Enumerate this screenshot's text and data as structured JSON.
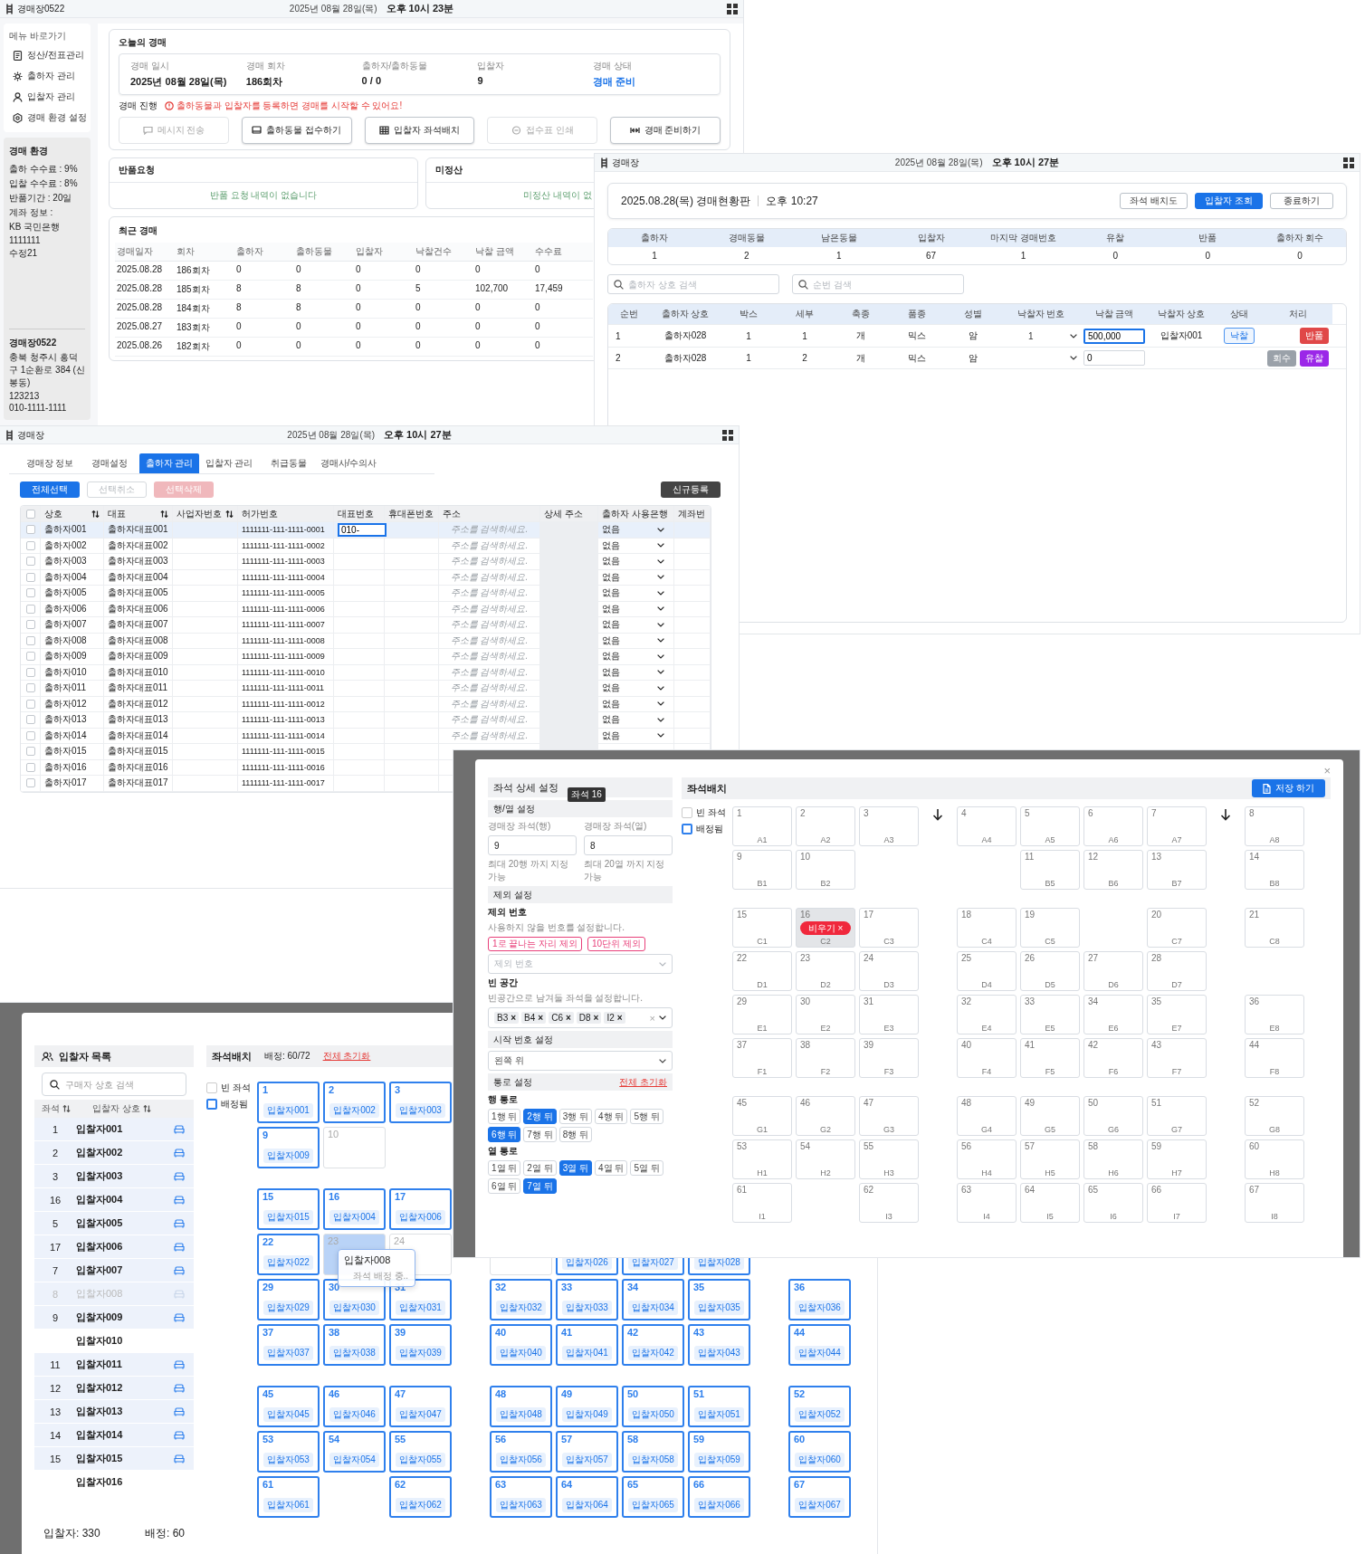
{
  "dashboard_window": {
    "app_name": "경매장0522",
    "date": "2025년 08월 28일(목)",
    "time": "오후 10시 23분",
    "menu_title": "메뉴 바로가기",
    "menu": [
      "정산/전표관리",
      "출하자 관리",
      "입찰자 관리",
      "경매 환경 설정"
    ],
    "settings_panel": {
      "title": "경매 환경",
      "lines": [
        "출하 수수료 : 9%",
        "입찰 수수료 : 8%",
        "반품기간 : 20일",
        "계좌 정보 :",
        "KB 국민은행",
        "1111111",
        "수정21"
      ]
    },
    "footer": {
      "name": "경매장0522",
      "address": "충북 청주시 흥덕구 1순환로 384 (신봉동)",
      "code": "123213",
      "phone": "010-1111-1111"
    },
    "today": {
      "title": "오늘의 경매",
      "fields": [
        {
          "label": "경매 일시",
          "value": "2025년 08월 28일(목)",
          "highlight": false
        },
        {
          "label": "경매 회차",
          "value": "186회차",
          "highlight": false
        },
        {
          "label": "출하자/출하동물",
          "value": "0 / 0",
          "highlight": false
        },
        {
          "label": "입찰자",
          "value": "9",
          "highlight": false
        },
        {
          "label": "경매 상태",
          "value": "경매 준비",
          "highlight": true
        }
      ]
    },
    "progress_label": "경매 진행",
    "warning": "출하동물과 입찰자를 등록하면 경매를 시작할 수 있어요!",
    "actions": [
      {
        "label": "메시지 전송",
        "disabled": true
      },
      {
        "label": "출하동물 접수하기",
        "disabled": false
      },
      {
        "label": "입찰자 좌석배치",
        "disabled": false
      },
      {
        "label": "접수표 인쇄",
        "disabled": true
      },
      {
        "label": "경매 준비하기",
        "disabled": false
      }
    ],
    "returns": {
      "title": "반품요청",
      "empty": "반품 요청 내역이 없습니다"
    },
    "unsettled": {
      "title": "미정산",
      "empty": "미정산 내역이 없"
    },
    "recent": {
      "title": "최근 경매",
      "columns": [
        "경매일자",
        "회차",
        "출하자",
        "출하동물",
        "입찰자",
        "낙찰건수",
        "낙찰 금액",
        "수수료"
      ],
      "rows": [
        [
          "2025.08.28",
          "186회차",
          "0",
          "0",
          "0",
          "0",
          "0",
          "0"
        ],
        [
          "2025.08.28",
          "185회차",
          "8",
          "8",
          "0",
          "5",
          "102,700",
          "17,459"
        ],
        [
          "2025.08.28",
          "184회차",
          "8",
          "8",
          "0",
          "0",
          "0",
          "0"
        ],
        [
          "2025.08.27",
          "183회차",
          "0",
          "0",
          "0",
          "0",
          "0",
          "0"
        ],
        [
          "2025.08.26",
          "182회차",
          "0",
          "0",
          "0",
          "0",
          "0",
          "0"
        ]
      ]
    }
  },
  "auction_board_window": {
    "app_name": "경매장",
    "date": "2025년 08월 28일(목)",
    "time": "오후 10시 27분",
    "board_title": "2025.08.28(목) 경매현황판",
    "board_time": "오후 10:27",
    "buttons": [
      {
        "label": "좌석 배치도",
        "primary": false
      },
      {
        "label": "입찰자 조회",
        "primary": true
      },
      {
        "label": "종료하기",
        "primary": false
      }
    ],
    "stats": {
      "columns": [
        "출하자",
        "경매동물",
        "남은동물",
        "입찰자",
        "마지막 경매번호",
        "유찰",
        "반품",
        "출하자 회수"
      ],
      "values": [
        "1",
        "2",
        "1",
        "67",
        "1",
        "0",
        "0",
        "0"
      ]
    },
    "searches": [
      {
        "placeholder": "출하자 상호 검색"
      },
      {
        "placeholder": "순번 검색"
      }
    ],
    "table": {
      "columns": [
        "순번",
        "출하자 상호",
        "박스",
        "세부",
        "축종",
        "품종",
        "성별",
        "낙찰자 번호",
        "낙찰 금액",
        "낙찰자 상호",
        "상태",
        "처리"
      ],
      "rows": [
        {
          "cells": [
            "1",
            "출하자028",
            "1",
            "1",
            "개",
            "믹스",
            "암"
          ],
          "bidder_no": "1",
          "amount": "500,000",
          "amount_focused": true,
          "bidder_name": "입찰자001",
          "status": "낙찰",
          "actions": [
            {
              "label": "반품",
              "kind": "return"
            }
          ]
        },
        {
          "cells": [
            "2",
            "출하자028",
            "1",
            "2",
            "개",
            "믹스",
            "암"
          ],
          "amount": "0",
          "amount_focused": false,
          "actions": [
            {
              "label": "회수",
              "kind": "recall"
            },
            {
              "label": "유찰",
              "kind": "fail"
            }
          ]
        }
      ]
    }
  },
  "shipper_window": {
    "app_name": "경매장",
    "date": "2025년 08월 28일(목)",
    "time": "오후 10시 27분",
    "tabs": [
      {
        "label": "경매장 정보",
        "selected": false
      },
      {
        "label": "경매설정",
        "selected": false
      },
      {
        "label": "출하자 관리",
        "selected": true
      },
      {
        "label": "입찰자 관리",
        "selected": false
      },
      {
        "label": "취급동물",
        "selected": false
      },
      {
        "label": "경매사/수의사",
        "selected": false
      }
    ],
    "bulk_buttons": [
      {
        "label": "전체선택",
        "kind": "primary"
      },
      {
        "label": "선택취소",
        "kind": "outline"
      },
      {
        "label": "선택삭제",
        "kind": "danger"
      }
    ],
    "new_button": "신규등록",
    "table": {
      "header_checked": false,
      "columns": [
        {
          "label": "상호",
          "sortable": true
        },
        {
          "label": "대표",
          "sortable": true
        },
        {
          "label": "사업자번호",
          "sortable": true
        },
        {
          "label": "허가번호",
          "sortable": false
        },
        {
          "label": "대표번호",
          "sortable": false
        },
        {
          "label": "휴대폰번호",
          "sortable": false
        },
        {
          "label": "주소",
          "sortable": false
        },
        {
          "label": "상세 주소",
          "sortable": false
        },
        {
          "label": "출하자 사용은행",
          "sortable": false
        },
        {
          "label": "계좌번",
          "sortable": false
        }
      ],
      "rows": [
        {
          "checked": false,
          "selected": true,
          "name": "출하자001",
          "rep": "출하자대표001",
          "license": "1111111-111-1111-0001",
          "phone": "010-",
          "address_placeholder": "주소를 검색하세요.",
          "bank": "없음"
        },
        {
          "checked": false,
          "selected": false,
          "name": "출하자002",
          "rep": "출하자대표002",
          "license": "1111111-111-1111-0002",
          "address_placeholder": "주소를 검색하세요.",
          "bank": "없음"
        },
        {
          "checked": false,
          "selected": false,
          "name": "출하자003",
          "rep": "출하자대표003",
          "license": "1111111-111-1111-0003",
          "address_placeholder": "주소를 검색하세요.",
          "bank": "없음"
        },
        {
          "checked": false,
          "selected": false,
          "name": "출하자004",
          "rep": "출하자대표004",
          "license": "1111111-111-1111-0004",
          "address_placeholder": "주소를 검색하세요.",
          "bank": "없음"
        },
        {
          "checked": false,
          "selected": false,
          "name": "출하자005",
          "rep": "출하자대표005",
          "license": "1111111-111-1111-0005",
          "address_placeholder": "주소를 검색하세요.",
          "bank": "없음"
        },
        {
          "checked": false,
          "selected": false,
          "name": "출하자006",
          "rep": "출하자대표006",
          "license": "1111111-111-1111-0006",
          "address_placeholder": "주소를 검색하세요.",
          "bank": "없음"
        },
        {
          "checked": false,
          "selected": false,
          "name": "출하자007",
          "rep": "출하자대표007",
          "license": "1111111-111-1111-0007",
          "address_placeholder": "주소를 검색하세요.",
          "bank": "없음"
        },
        {
          "checked": false,
          "selected": false,
          "name": "출하자008",
          "rep": "출하자대표008",
          "license": "1111111-111-1111-0008",
          "address_placeholder": "주소를 검색하세요.",
          "bank": "없음"
        },
        {
          "checked": false,
          "selected": false,
          "name": "출하자009",
          "rep": "출하자대표009",
          "license": "1111111-111-1111-0009",
          "address_placeholder": "주소를 검색하세요.",
          "bank": "없음"
        },
        {
          "checked": false,
          "selected": false,
          "name": "출하자010",
          "rep": "출하자대표010",
          "license": "1111111-111-1111-0010",
          "address_placeholder": "주소를 검색하세요.",
          "bank": "없음"
        },
        {
          "checked": false,
          "selected": false,
          "name": "출하자011",
          "rep": "출하자대표011",
          "license": "1111111-111-1111-0011",
          "address_placeholder": "주소를 검색하세요.",
          "bank": "없음"
        },
        {
          "checked": false,
          "selected": false,
          "name": "출하자012",
          "rep": "출하자대표012",
          "license": "1111111-111-1111-0012",
          "address_placeholder": "주소를 검색하세요.",
          "bank": "없음"
        },
        {
          "checked": false,
          "selected": false,
          "name": "출하자013",
          "rep": "출하자대표013",
          "license": "1111111-111-1111-0013",
          "address_placeholder": "주소를 검색하세요.",
          "bank": "없음"
        },
        {
          "checked": false,
          "selected": false,
          "name": "출하자014",
          "rep": "출하자대표014",
          "license": "1111111-111-1111-0014",
          "address_placeholder": "주소를 검색하세요.",
          "bank": "없음"
        },
        {
          "checked": false,
          "selected": false,
          "name": "출하자015",
          "rep": "출하자대표015",
          "license": "1111111-111-1111-0015"
        },
        {
          "checked": false,
          "selected": false,
          "name": "출하자016",
          "rep": "출하자대표016",
          "license": "1111111-111-1111-0016"
        },
        {
          "checked": false,
          "selected": false,
          "name": "출하자017",
          "rep": "출하자대표017",
          "license": "1111111-111-1111-0017"
        }
      ]
    }
  },
  "seat_settings_dialog": {
    "title": "좌석 상세 설정",
    "tooltip": "좌석 16",
    "close": "×",
    "rowcol": {
      "title": "행/열 설정",
      "fields": [
        {
          "label": "경매장 좌석(행)",
          "value": "9",
          "hint": "최대 20행 까지 지정 가능"
        },
        {
          "label": "경매장 좌석(열)",
          "value": "8",
          "hint": "최대 20열 까지 지정 가능"
        }
      ]
    },
    "exclude": {
      "title": "제외 설정",
      "label": "제외 번호",
      "description": "사용하지 않을 번호를 설정합니다.",
      "presets": [
        "1로 끝나는 자리 제외",
        "10단위 제외"
      ],
      "placeholder": "제외 번호"
    },
    "blank": {
      "label": "빈 공간",
      "description": "빈공간으로 남겨둘 좌석을 설정합니다.",
      "tags": [
        "B3",
        "B4",
        "C6",
        "D8",
        "I2"
      ],
      "remove": "×",
      "clear": "×"
    },
    "start": {
      "title": "시작 번호 설정",
      "value": "왼쪽 위"
    },
    "aisle": {
      "title": "통로 설정",
      "reset": "전체 초기화",
      "row_label": "행 통로",
      "rows": [
        {
          "label": "1행 뒤",
          "selected": false
        },
        {
          "label": "2행 뒤",
          "selected": true
        },
        {
          "label": "3행 뒤",
          "selected": false
        },
        {
          "label": "4행 뒤",
          "selected": false
        },
        {
          "label": "5행 뒤",
          "selected": false
        },
        {
          "label": "6행 뒤",
          "selected": true
        },
        {
          "label": "7행 뒤",
          "selected": false
        },
        {
          "label": "8행 뒤",
          "selected": false
        }
      ],
      "col_label": "열 통로",
      "cols": [
        {
          "label": "1열 뒤",
          "selected": false
        },
        {
          "label": "2열 뒤",
          "selected": false
        },
        {
          "label": "3열 뒤",
          "selected": true
        },
        {
          "label": "4열 뒤",
          "selected": false
        },
        {
          "label": "5열 뒤",
          "selected": false
        },
        {
          "label": "6열 뒤",
          "selected": false
        },
        {
          "label": "7열 뒤",
          "selected": true
        }
      ]
    },
    "layout_title": "좌석배치",
    "save": "저장 하기",
    "legend": [
      {
        "label": "빈 좌석",
        "kind": "empty"
      },
      {
        "label": "배정됨",
        "kind": "assigned"
      }
    ],
    "grid": [
      [
        {
          "num": "1",
          "code": "A1",
          "selected": false
        },
        {
          "num": "2",
          "code": "A2",
          "selected": false
        },
        {
          "num": "3",
          "code": "A3",
          "selected": false
        },
        {
          "num": "4",
          "code": "A4",
          "selected": false
        },
        {
          "num": "5",
          "code": "A5",
          "selected": false
        },
        {
          "num": "6",
          "code": "A6",
          "selected": false
        },
        {
          "num": "7",
          "code": "A7",
          "selected": false
        },
        {
          "num": "8",
          "code": "A8",
          "selected": false
        }
      ],
      [
        {
          "num": "9",
          "code": "B1",
          "selected": false
        },
        {
          "num": "10",
          "code": "B2",
          "selected": false
        },
        {
          "kind": "space"
        },
        {
          "kind": "space"
        },
        {
          "num": "11",
          "code": "B5",
          "selected": false
        },
        {
          "num": "12",
          "code": "B6",
          "selected": false
        },
        {
          "num": "13",
          "code": "B7",
          "selected": false
        },
        {
          "num": "14",
          "code": "B8",
          "selected": false
        }
      ],
      [
        {
          "num": "15",
          "code": "C1",
          "selected": false
        },
        {
          "num": "16",
          "code": "C2",
          "selected": true,
          "action": "비우기",
          "action_close": "×"
        },
        {
          "num": "17",
          "code": "C3",
          "selected": false
        },
        {
          "num": "18",
          "code": "C4",
          "selected": false
        },
        {
          "num": "19",
          "code": "C5",
          "selected": false
        },
        {
          "kind": "space"
        },
        {
          "num": "20",
          "code": "C7",
          "selected": false
        },
        {
          "num": "21",
          "code": "C8",
          "selected": false
        }
      ],
      [
        {
          "num": "22",
          "code": "D1",
          "selected": false
        },
        {
          "num": "23",
          "code": "D2",
          "selected": false
        },
        {
          "num": "24",
          "code": "D3",
          "selected": false
        },
        {
          "num": "25",
          "code": "D4",
          "selected": false
        },
        {
          "num": "26",
          "code": "D5",
          "selected": false
        },
        {
          "num": "27",
          "code": "D6",
          "selected": false
        },
        {
          "num": "28",
          "code": "D7",
          "selected": false
        },
        {
          "kind": "space"
        }
      ],
      [
        {
          "num": "29",
          "code": "E1",
          "selected": false
        },
        {
          "num": "30",
          "code": "E2",
          "selected": false
        },
        {
          "num": "31",
          "code": "E3",
          "selected": false
        },
        {
          "num": "32",
          "code": "E4",
          "selected": false
        },
        {
          "num": "33",
          "code": "E5",
          "selected": false
        },
        {
          "num": "34",
          "code": "E6",
          "selected": false
        },
        {
          "num": "35",
          "code": "E7",
          "selected": false
        },
        {
          "num": "36",
          "code": "E8",
          "selected": false
        }
      ],
      [
        {
          "num": "37",
          "code": "F1",
          "selected": false
        },
        {
          "num": "38",
          "code": "F2",
          "selected": false
        },
        {
          "num": "39",
          "code": "F3",
          "selected": false
        },
        {
          "num": "40",
          "code": "F4",
          "selected": false
        },
        {
          "num": "41",
          "code": "F5",
          "selected": false
        },
        {
          "num": "42",
          "code": "F6",
          "selected": false
        },
        {
          "num": "43",
          "code": "F7",
          "selected": false
        },
        {
          "num": "44",
          "code": "F8",
          "selected": false
        }
      ],
      [
        {
          "num": "45",
          "code": "G1",
          "selected": false
        },
        {
          "num": "46",
          "code": "G2",
          "selected": false
        },
        {
          "num": "47",
          "code": "G3",
          "selected": false
        },
        {
          "num": "48",
          "code": "G4",
          "selected": false
        },
        {
          "num": "49",
          "code": "G5",
          "selected": false
        },
        {
          "num": "50",
          "code": "G6",
          "selected": false
        },
        {
          "num": "51",
          "code": "G7",
          "selected": false
        },
        {
          "num": "52",
          "code": "G8",
          "selected": false
        }
      ],
      [
        {
          "num": "53",
          "code": "H1",
          "selected": false
        },
        {
          "num": "54",
          "code": "H2",
          "selected": false
        },
        {
          "num": "55",
          "code": "H3",
          "selected": false
        },
        {
          "num": "56",
          "code": "H4",
          "selected": false
        },
        {
          "num": "57",
          "code": "H5",
          "selected": false
        },
        {
          "num": "58",
          "code": "H6",
          "selected": false
        },
        {
          "num": "59",
          "code": "H7",
          "selected": false
        },
        {
          "num": "60",
          "code": "H8",
          "selected": false
        }
      ],
      [
        {
          "num": "61",
          "code": "I1",
          "selected": false
        },
        {
          "kind": "space"
        },
        {
          "num": "62",
          "code": "I3",
          "selected": false
        },
        {
          "num": "63",
          "code": "I4",
          "selected": false
        },
        {
          "num": "64",
          "code": "I5",
          "selected": false
        },
        {
          "num": "65",
          "code": "I6",
          "selected": false
        },
        {
          "num": "66",
          "code": "I7",
          "selected": false
        },
        {
          "num": "67",
          "code": "I8",
          "selected": false
        }
      ]
    ]
  },
  "seat_assignment_window": {
    "list_title": "입찰자 목록",
    "search_placeholder": "구매자 상호 검색",
    "columns": [
      "좌석",
      "입찰자 상호"
    ],
    "bidders": [
      {
        "seat": "1",
        "name": "입찰자001",
        "assigned": true,
        "disabled": false
      },
      {
        "seat": "2",
        "name": "입찰자002",
        "assigned": true,
        "disabled": false
      },
      {
        "seat": "3",
        "name": "입찰자003",
        "assigned": true,
        "disabled": false
      },
      {
        "seat": "16",
        "name": "입찰자004",
        "assigned": true,
        "disabled": false
      },
      {
        "seat": "5",
        "name": "입찰자005",
        "assigned": true,
        "disabled": false
      },
      {
        "seat": "17",
        "name": "입찰자006",
        "assigned": true,
        "disabled": false
      },
      {
        "seat": "7",
        "name": "입찰자007",
        "assigned": true,
        "disabled": false
      },
      {
        "seat": "8",
        "name": "입찰자008",
        "assigned": true,
        "disabled": true
      },
      {
        "seat": "9",
        "name": "입찰자009",
        "assigned": true,
        "disabled": false
      },
      {
        "name": "입찰자010",
        "assigned": false,
        "disabled": false
      },
      {
        "seat": "11",
        "name": "입찰자011",
        "assigned": true,
        "disabled": false
      },
      {
        "seat": "12",
        "name": "입찰자012",
        "assigned": true,
        "disabled": false
      },
      {
        "seat": "13",
        "name": "입찰자013",
        "assigned": true,
        "disabled": false
      },
      {
        "seat": "14",
        "name": "입찰자014",
        "assigned": true,
        "disabled": false
      },
      {
        "seat": "15",
        "name": "입찰자015",
        "assigned": true,
        "disabled": false
      },
      {
        "name": "입찰자016",
        "assigned": false,
        "disabled": false
      }
    ],
    "total": "입찰자: 330",
    "assigned_count": "배정: 60",
    "layout_title": "좌석배치",
    "summary": "배정: 60/72",
    "reset": "전체 초기화",
    "legend": [
      {
        "label": "빈 좌석",
        "kind": "empty"
      },
      {
        "label": "배정됨",
        "kind": "assigned"
      }
    ],
    "grid": [
      [
        {
          "kind": "seat",
          "num": "1",
          "bidder": "입찰자001"
        },
        {
          "kind": "seat",
          "num": "2",
          "bidder": "입찰자002"
        },
        {
          "kind": "seat",
          "num": "3",
          "bidder": "입찰자003"
        },
        {
          "kind": "covered"
        },
        {
          "kind": "covered"
        },
        {
          "kind": "covered"
        },
        {
          "kind": "covered"
        },
        {
          "kind": "covered"
        }
      ],
      [
        {
          "kind": "seat",
          "num": "9",
          "bidder": "입찰자009"
        },
        {
          "kind": "seat",
          "num": "10"
        },
        {
          "kind": "space"
        },
        {
          "kind": "covered"
        },
        {
          "kind": "covered"
        },
        {
          "kind": "covered"
        },
        {
          "kind": "covered"
        },
        {
          "kind": "covered"
        }
      ],
      [
        {
          "kind": "seat",
          "num": "15",
          "bidder": "입찰자015"
        },
        {
          "kind": "seat",
          "num": "16",
          "bidder": "입찰자004"
        },
        {
          "kind": "seat",
          "num": "17",
          "bidder": "입찰자006"
        },
        {
          "kind": "covered"
        },
        {
          "kind": "covered"
        },
        {
          "kind": "covered"
        },
        {
          "kind": "covered"
        },
        {
          "kind": "covered"
        }
      ],
      [
        {
          "kind": "seat",
          "num": "22",
          "bidder": "입찰자022"
        },
        {
          "kind": "seat",
          "num": "23",
          "target": true,
          "drag": {
            "name": "입찰자008",
            "status": "좌석 배정 중.."
          }
        },
        {
          "kind": "seat",
          "num": "24"
        },
        {
          "kind": "seat"
        },
        {
          "kind": "seat",
          "bidder": "입찰자026"
        },
        {
          "kind": "seat",
          "bidder": "입찰자027"
        },
        {
          "kind": "seat",
          "bidder": "입찰자028"
        },
        {
          "kind": "space"
        }
      ],
      [
        {
          "kind": "seat",
          "num": "29",
          "bidder": "입찰자029"
        },
        {
          "kind": "seat",
          "num": "30",
          "bidder": "입찰자030"
        },
        {
          "kind": "seat",
          "num": "31",
          "bidder": "입찰자031"
        },
        {
          "kind": "seat",
          "num": "32",
          "bidder": "입찰자032"
        },
        {
          "kind": "seat",
          "num": "33",
          "bidder": "입찰자033"
        },
        {
          "kind": "seat",
          "num": "34",
          "bidder": "입찰자034"
        },
        {
          "kind": "seat",
          "num": "35",
          "bidder": "입찰자035"
        },
        {
          "kind": "seat",
          "num": "36",
          "bidder": "입찰자036"
        }
      ],
      [
        {
          "kind": "seat",
          "num": "37",
          "bidder": "입찰자037"
        },
        {
          "kind": "seat",
          "num": "38",
          "bidder": "입찰자038"
        },
        {
          "kind": "seat",
          "num": "39",
          "bidder": "입찰자039"
        },
        {
          "kind": "seat",
          "num": "40",
          "bidder": "입찰자040"
        },
        {
          "kind": "seat",
          "num": "41",
          "bidder": "입찰자041"
        },
        {
          "kind": "seat",
          "num": "42",
          "bidder": "입찰자042"
        },
        {
          "kind": "seat",
          "num": "43",
          "bidder": "입찰자043"
        },
        {
          "kind": "seat",
          "num": "44",
          "bidder": "입찰자044"
        }
      ],
      [
        {
          "kind": "seat",
          "num": "45",
          "bidder": "입찰자045"
        },
        {
          "kind": "seat",
          "num": "46",
          "bidder": "입찰자046"
        },
        {
          "kind": "seat",
          "num": "47",
          "bidder": "입찰자047"
        },
        {
          "kind": "seat",
          "num": "48",
          "bidder": "입찰자048"
        },
        {
          "kind": "seat",
          "num": "49",
          "bidder": "입찰자049"
        },
        {
          "kind": "seat",
          "num": "50",
          "bidder": "입찰자050"
        },
        {
          "kind": "seat",
          "num": "51",
          "bidder": "입찰자051"
        },
        {
          "kind": "seat",
          "num": "52",
          "bidder": "입찰자052"
        }
      ],
      [
        {
          "kind": "seat",
          "num": "53",
          "bidder": "입찰자053"
        },
        {
          "kind": "seat",
          "num": "54",
          "bidder": "입찰자054"
        },
        {
          "kind": "seat",
          "num": "55",
          "bidder": "입찰자055"
        },
        {
          "kind": "seat",
          "num": "56",
          "bidder": "입찰자056"
        },
        {
          "kind": "seat",
          "num": "57",
          "bidder": "입찰자057"
        },
        {
          "kind": "seat",
          "num": "58",
          "bidder": "입찰자058"
        },
        {
          "kind": "seat",
          "num": "59",
          "bidder": "입찰자059"
        },
        {
          "kind": "seat",
          "num": "60",
          "bidder": "입찰자060"
        }
      ],
      [
        {
          "kind": "seat",
          "num": "61",
          "bidder": "입찰자061"
        },
        {
          "kind": "space"
        },
        {
          "kind": "seat",
          "num": "62",
          "bidder": "입찰자062"
        },
        {
          "kind": "seat",
          "num": "63",
          "bidder": "입찰자063"
        },
        {
          "kind": "seat",
          "num": "64",
          "bidder": "입찰자064"
        },
        {
          "kind": "seat",
          "num": "65",
          "bidder": "입찰자065"
        },
        {
          "kind": "seat",
          "num": "66",
          "bidder": "입찰자066"
        },
        {
          "kind": "seat",
          "num": "67",
          "bidder": "입찰자067"
        }
      ]
    ]
  }
}
